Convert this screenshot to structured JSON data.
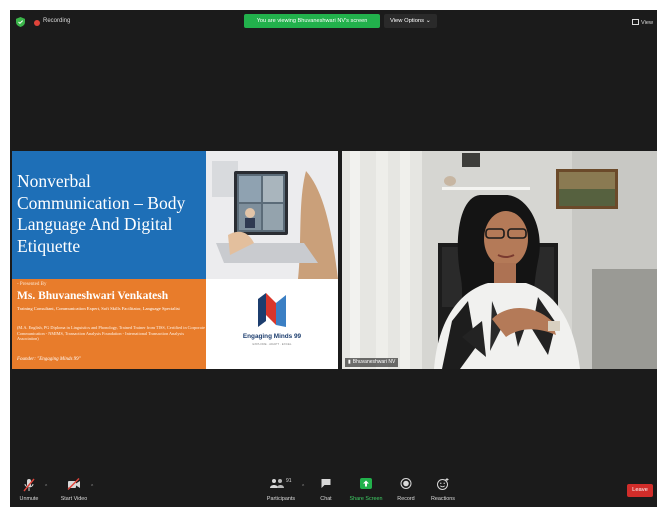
{
  "topbar": {
    "recording_label": "Recording",
    "viewing_banner": "You are viewing Bhuvaneshwari NV's screen",
    "view_options_label": "View Options",
    "view_label": "View"
  },
  "slide": {
    "title": "Nonverbal Communication – Body Language And Digital Etiquette",
    "presented_by": "- Presented By",
    "presenter_name": "Ms. Bhuvaneshwari Venkatesh",
    "presenter_role": "Training Consultant, Communication Expert, Soft Skills Facilitator, Language Specialist",
    "qualifications": "(M.A. English, PG Diploma in Linguistics and Phonology, Trained Trainer from TISS, Certified in Corporate Communication - NMIMS, Transaction Analysis Foundation - International Transaction Analysis Association)",
    "founder": "Founder: \"Engaging Minds 99\"",
    "logo_name": "Engaging Minds 99",
    "logo_tagline": "EXPLORE · ADAPT · EXCEL"
  },
  "video": {
    "participant_name": "Bhuvaneshwari NV"
  },
  "toolbar": {
    "unmute": "Unmute",
    "start_video": "Start Video",
    "participants": "Participants",
    "participants_count": "91",
    "chat": "Chat",
    "share_screen": "Share Screen",
    "record": "Record",
    "reactions": "Reactions",
    "leave": "Leave"
  },
  "colors": {
    "banner_green": "#22b14c",
    "slide_blue": "#1e6fb7",
    "slide_orange": "#e87c2b",
    "leave_red": "#d12d2a"
  }
}
